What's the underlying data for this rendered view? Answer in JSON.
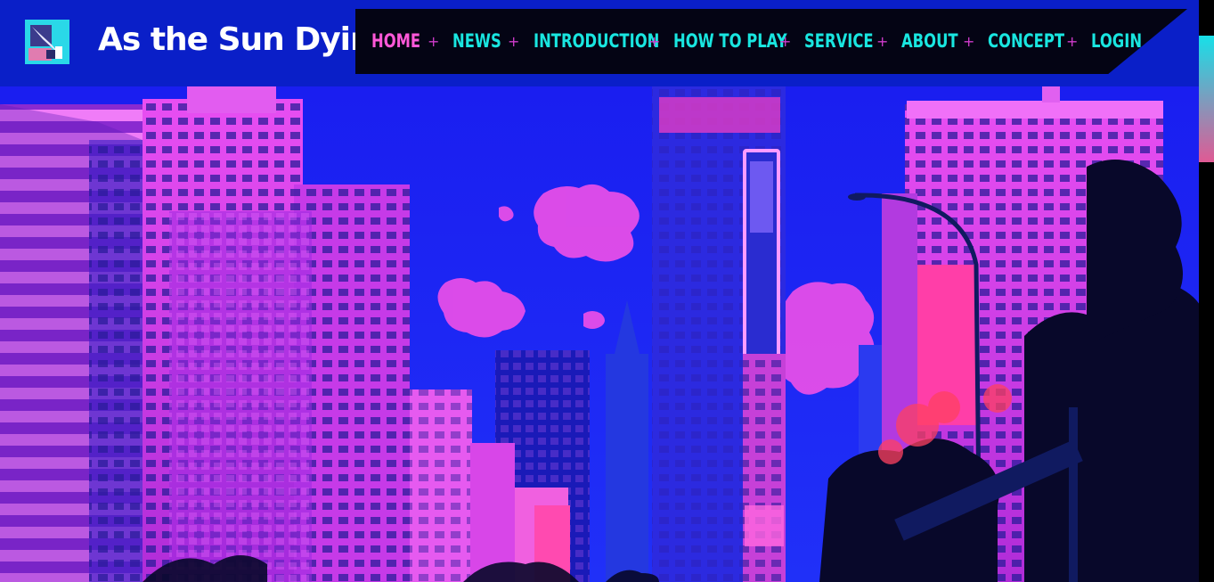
{
  "site": {
    "title": "As the Sun Dying",
    "logo_icon": "stylized-s-logo-icon"
  },
  "nav": {
    "items": [
      {
        "label": "HOME",
        "active": true
      },
      {
        "label": "NEWS",
        "active": false
      },
      {
        "label": "INTRODUCTION",
        "active": false
      },
      {
        "label": "HOW TO PLAY",
        "active": false
      },
      {
        "label": "SERVICE",
        "active": false
      },
      {
        "label": "ABOUT",
        "active": false
      },
      {
        "label": "CONCEPT",
        "active": false
      },
      {
        "label": "LOGIN",
        "active": false
      }
    ],
    "separator": "+"
  },
  "hero": {
    "description": "hero-cityscape-image"
  },
  "colors": {
    "header_bg": "#0a1fc8",
    "nav_bg": "#040414",
    "nav_text": "#19e6e0",
    "nav_active": "#ff58d8",
    "nav_separator": "#d03ccc",
    "sky": "#1a1ef0",
    "building_pink": "#e040f0",
    "scroll_thumb_top": "#17e0e8",
    "scroll_thumb_bottom": "#e05a94"
  }
}
